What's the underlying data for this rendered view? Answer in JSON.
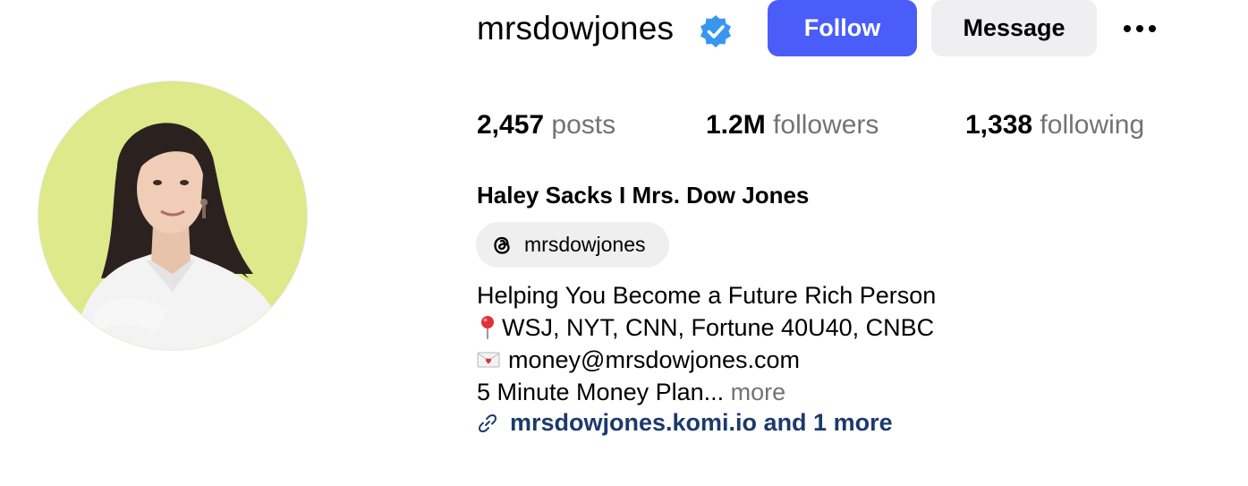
{
  "profile": {
    "username": "mrsdowjones",
    "verified": true,
    "full_name": "Haley Sacks I Mrs. Dow Jones",
    "threads_handle": "mrsdowjones"
  },
  "actions": {
    "follow_label": "Follow",
    "message_label": "Message",
    "options_icon": "more-horizontal-icon"
  },
  "stats": {
    "posts_count": "2,457",
    "posts_label": "posts",
    "followers_count": "1.2M",
    "followers_label": "followers",
    "following_count": "1,338",
    "following_label": "following"
  },
  "bio": {
    "line1": "Helping You Become a Future Rich Person",
    "line2": "WSJ, NYT, CNN, Fortune 40U40, CNBC",
    "line2_icon": "round-pushpin-icon",
    "line3": "money@mrsdowjones.com",
    "line3_icon": "love-letter-icon",
    "line4": "5 Minute Money Plan...",
    "more_label": "more"
  },
  "link": {
    "text": "mrsdowjones.komi.io and 1 more",
    "icon": "link-icon"
  },
  "colors": {
    "accent": "#4a5df9",
    "avatar_bg": "#dde98a",
    "muted_text": "#737373",
    "link_text": "#1c3a6b",
    "verified_badge": "#3797f0"
  }
}
